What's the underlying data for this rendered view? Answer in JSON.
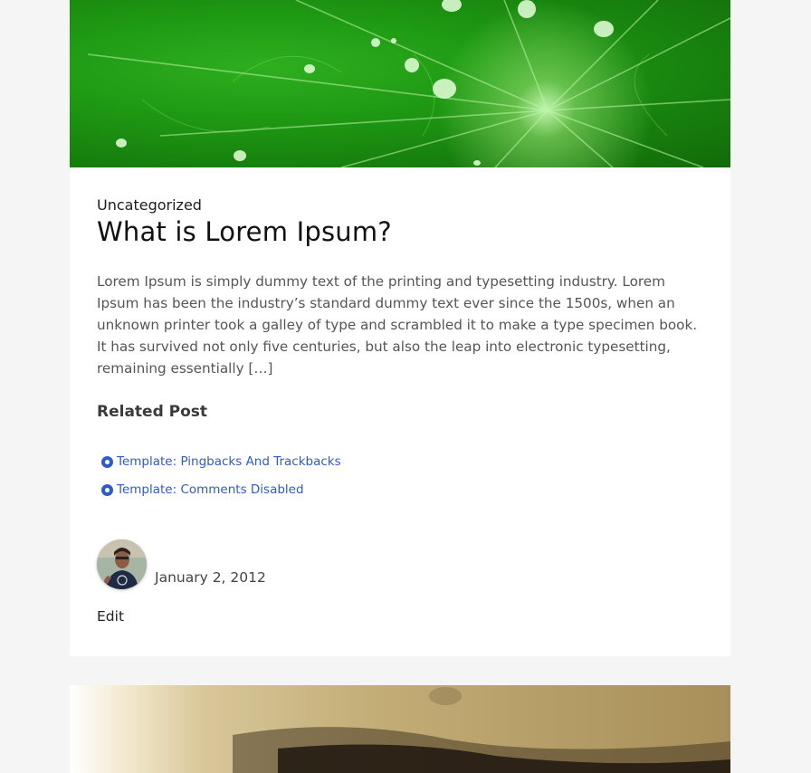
{
  "post": {
    "category": "Uncategorized",
    "title": "What is Lorem Ipsum?",
    "excerpt": "Lorem Ipsum is simply dummy text of the printing and typesetting industry. Lorem Ipsum has been the industry’s standard dummy text ever since the 1500s, when an unknown printer took a galley of type and scrambled it to make a type specimen book. It has survived not only five centuries, but also the leap into electronic typesetting, remaining essentially […]",
    "related_heading": "Related Post",
    "related_posts": [
      {
        "label": "Template: Pingbacks And Trackbacks"
      },
      {
        "label": "Template: Comments Disabled"
      }
    ],
    "date": "January 2, 2012",
    "edit_label": "Edit"
  },
  "colors": {
    "page_background": "#f4f5f4",
    "card_background": "#ffffff",
    "link": "#2f5bc9"
  },
  "icons": {
    "related_bullet": "radio-bullet-icon"
  }
}
